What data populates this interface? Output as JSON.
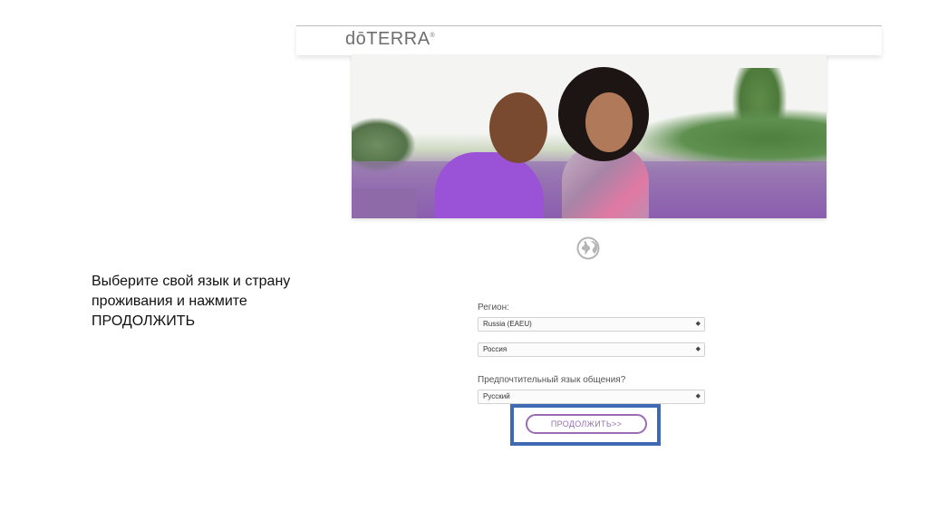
{
  "instruction": {
    "text": "Выберите свой язык и страну проживания и нажмите ПРОДОЛЖИТЬ"
  },
  "site": {
    "logo": "dōTERRA",
    "logo_mark": "®",
    "form": {
      "region_label": "Регион:",
      "region_value": "Russia (EAEU)",
      "country_value": "Россия",
      "language_label": "Предпочтительный язык общения?",
      "language_value": "Русский",
      "continue_label": "ПРОДОЛЖИТЬ>>"
    },
    "icons": {
      "globe": "globe-icon",
      "chevron": "chevron-updown-icon"
    },
    "colors": {
      "brand_purple": "#9a6cb4",
      "highlight_blue": "#3f69b3"
    }
  }
}
